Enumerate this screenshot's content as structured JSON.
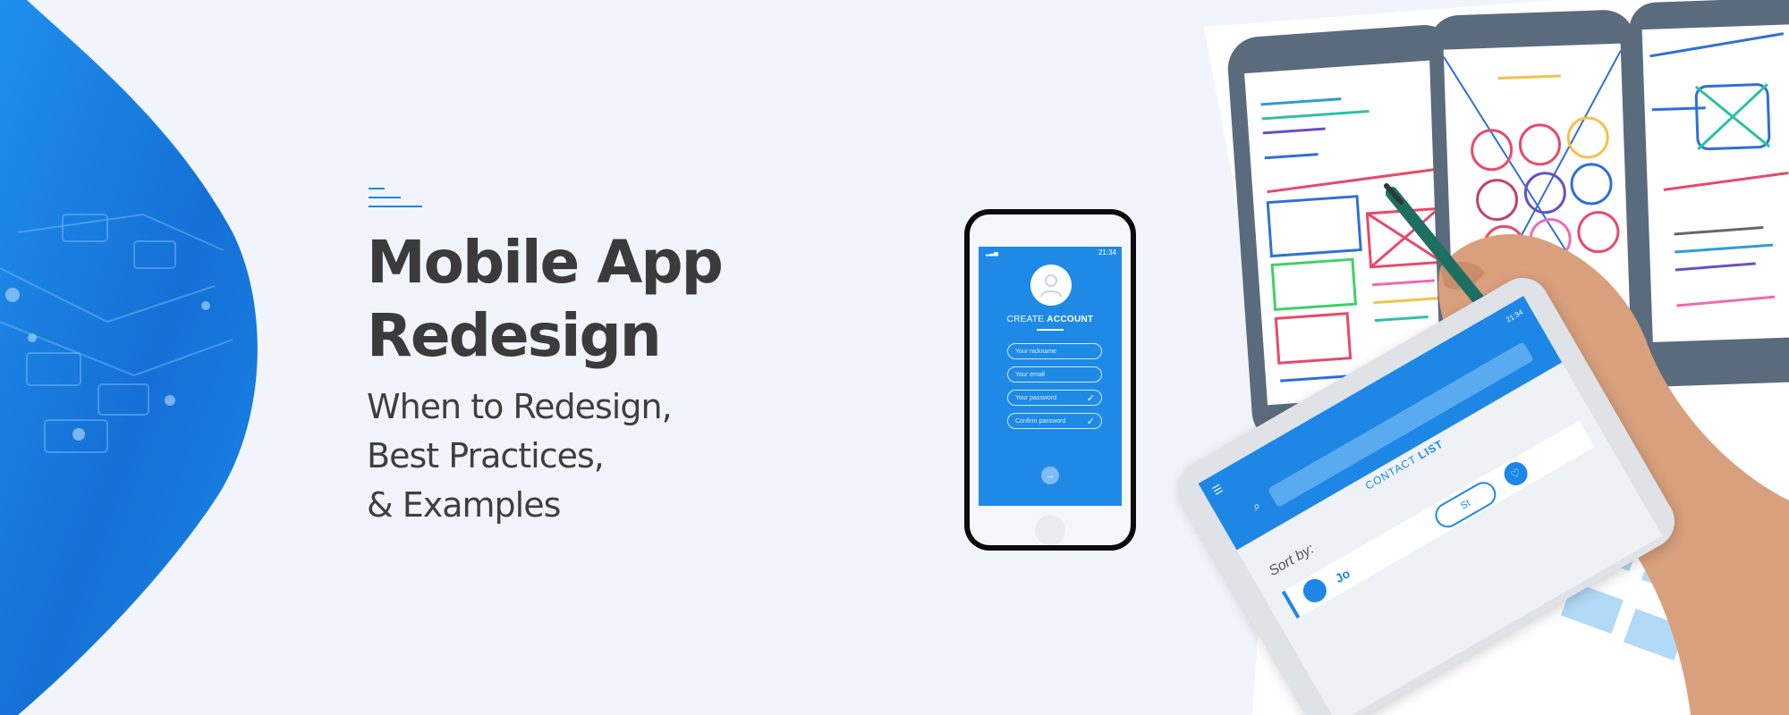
{
  "banner": {
    "title_line1": "Mobile App",
    "title_line2": "Redesign",
    "subtitle_line1": "When to Redesign,",
    "subtitle_line2": "Best Practices,",
    "subtitle_line3": "&  Examples"
  },
  "phone": {
    "time": "21:34",
    "create_prefix": "CREATE ",
    "create_bold": "ACCOUNT",
    "fields": [
      {
        "label": "Your nickname"
      },
      {
        "label": "Your email"
      },
      {
        "label": "Your password",
        "check": "✓"
      },
      {
        "label": "Confirm password",
        "check": "✓"
      }
    ],
    "submit_icon": "→"
  },
  "tablet": {
    "time": "21:34",
    "contact_prefix": "CONTACT ",
    "contact_bold": "LIST",
    "sort_label": "Sort by:",
    "contact_name": "Jo",
    "start_label": "St"
  },
  "icons": [
    "user-icon",
    "check-icon",
    "arrow-right-icon",
    "menu-icon",
    "search-icon",
    "heart-icon"
  ],
  "colors": {
    "brand_blue": "#1e87e5",
    "background": "#f1f5fb",
    "text_dark": "#3b3b3b"
  }
}
